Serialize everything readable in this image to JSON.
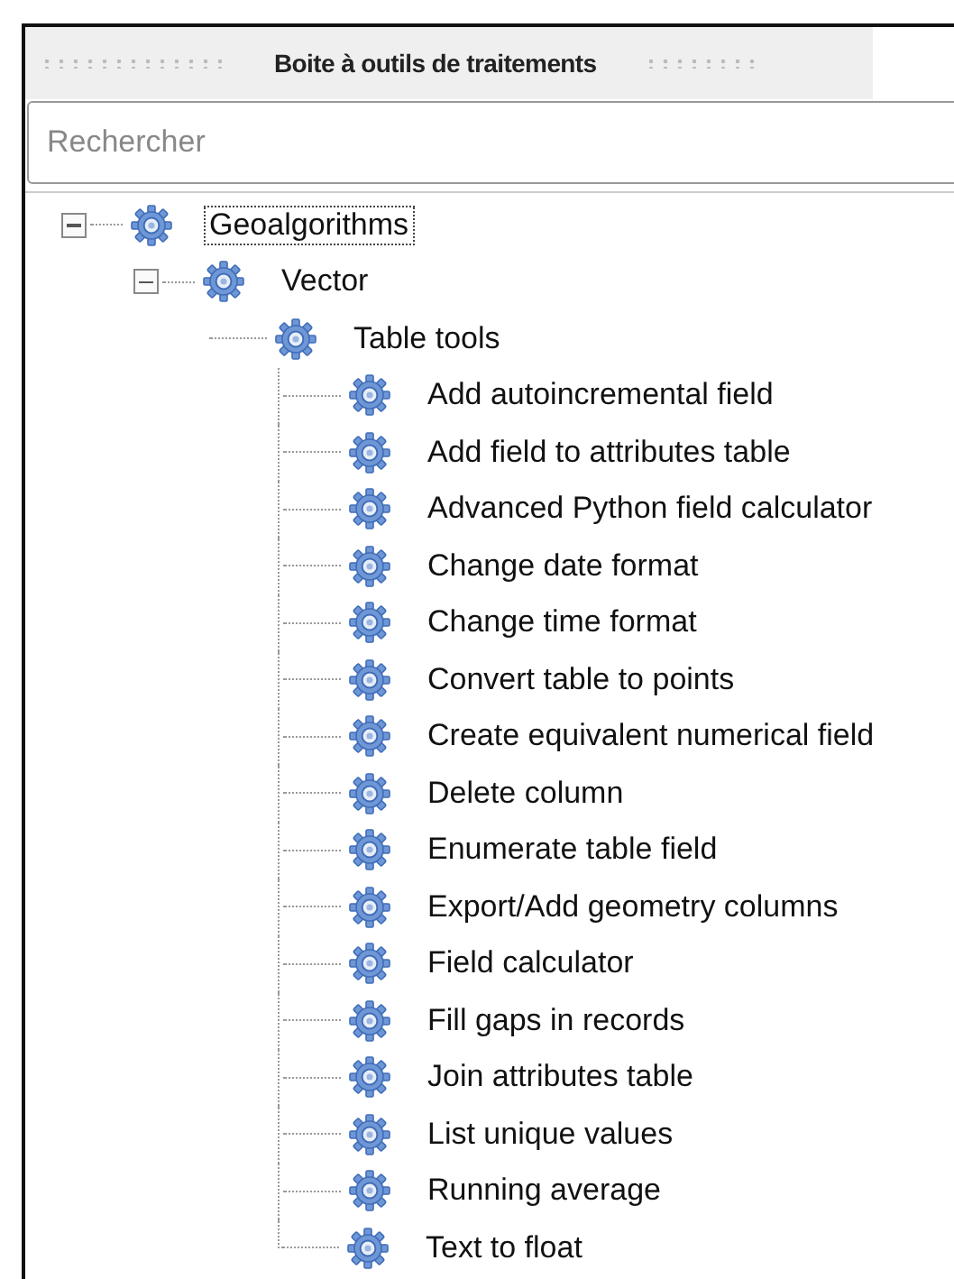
{
  "panel": {
    "title": "Boite à outils de traitements"
  },
  "search": {
    "placeholder": "Rechercher"
  },
  "tree": [
    {
      "label": "Geoalgorithms",
      "selected": true,
      "expanded": true,
      "children": [
        {
          "label": "Vector",
          "selected": false,
          "expanded": true,
          "children": [
            {
              "label": "Table tools",
              "selected": false,
              "children": [
                {
                  "label": "Add autoincremental field",
                  "selected": false
                },
                {
                  "label": "Add field to attributes table",
                  "selected": false
                },
                {
                  "label": "Advanced Python field calculator",
                  "selected": false
                },
                {
                  "label": "Change date format",
                  "selected": false
                },
                {
                  "label": "Change time format",
                  "selected": false
                },
                {
                  "label": "Convert table to points",
                  "selected": false
                },
                {
                  "label": "Create equivalent numerical field",
                  "selected": false
                },
                {
                  "label": "Delete column",
                  "selected": false
                },
                {
                  "label": "Enumerate table field",
                  "selected": false
                },
                {
                  "label": "Export/Add geometry columns",
                  "selected": false
                },
                {
                  "label": "Field calculator",
                  "selected": false
                },
                {
                  "label": "Fill gaps in records",
                  "selected": false
                },
                {
                  "label": "Join attributes table",
                  "selected": false
                },
                {
                  "label": "List unique values",
                  "selected": false
                },
                {
                  "label": "Running average",
                  "selected": false
                },
                {
                  "label": "Text to float",
                  "selected": false
                }
              ]
            }
          ]
        }
      ]
    }
  ]
}
